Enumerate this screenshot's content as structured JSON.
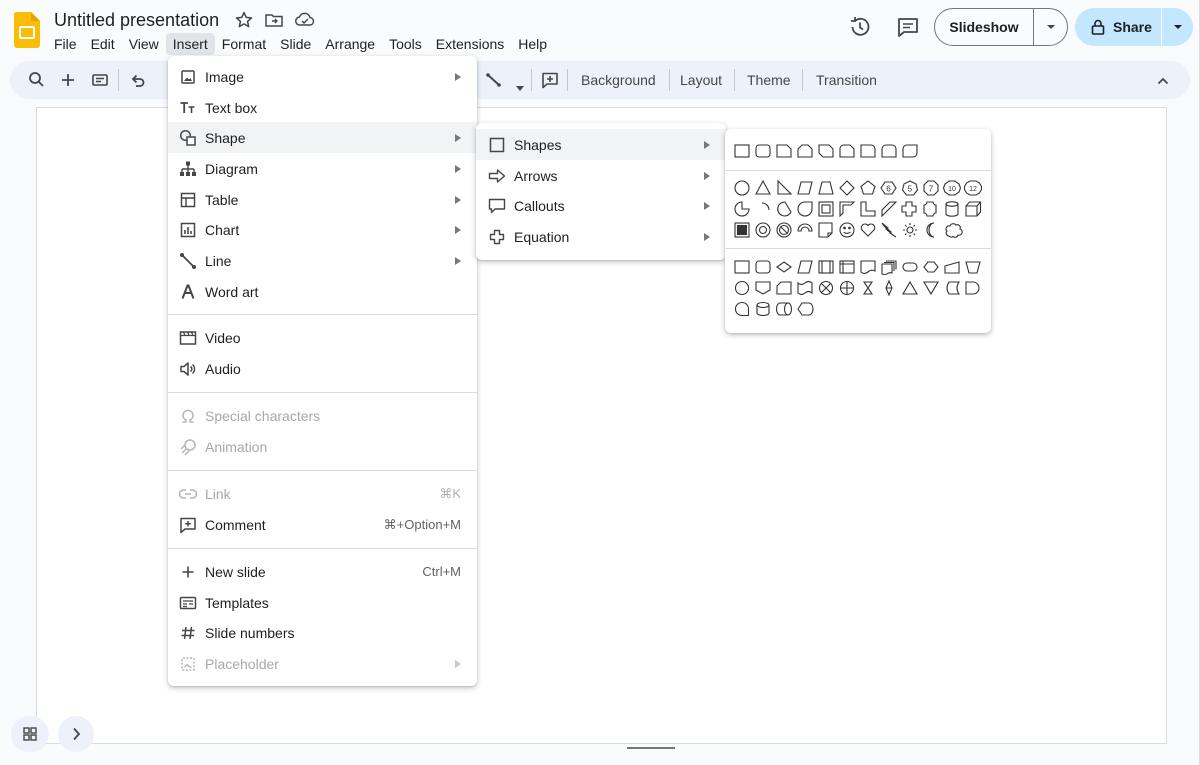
{
  "app": {
    "title": "Untitled presentation",
    "logo_icon": "slides-logo-icon",
    "brand_color": "#fbbc04"
  },
  "menubar": [
    "File",
    "Edit",
    "View",
    "Insert",
    "Format",
    "Slide",
    "Arrange",
    "Tools",
    "Extensions",
    "Help"
  ],
  "menubar_active": "Insert",
  "header": {
    "slideshow_label": "Slideshow",
    "share_label": "Share"
  },
  "toolbar": {
    "background_label": "Background",
    "layout_label": "Layout",
    "theme_label": "Theme",
    "transition_label": "Transition"
  },
  "insert_menu": {
    "image": "Image",
    "text_box": "Text box",
    "shape": "Shape",
    "diagram": "Diagram",
    "table": "Table",
    "chart": "Chart",
    "line": "Line",
    "word_art": "Word art",
    "video": "Video",
    "audio": "Audio",
    "special_characters": "Special characters",
    "animation": "Animation",
    "link": "Link",
    "link_shortcut": "⌘K",
    "comment": "Comment",
    "comment_shortcut": "⌘+Option+M",
    "new_slide": "New slide",
    "new_slide_shortcut": "Ctrl+M",
    "templates": "Templates",
    "slide_numbers": "Slide numbers",
    "placeholder": "Placeholder"
  },
  "shape_submenu": {
    "shapes": "Shapes",
    "arrows": "Arrows",
    "callouts": "Callouts",
    "equation": "Equation"
  },
  "palette_labels": {
    "dec5": "5",
    "dec6": "6",
    "dec7": "7",
    "dec8": "8",
    "dec10": "10",
    "dec12": "12"
  }
}
